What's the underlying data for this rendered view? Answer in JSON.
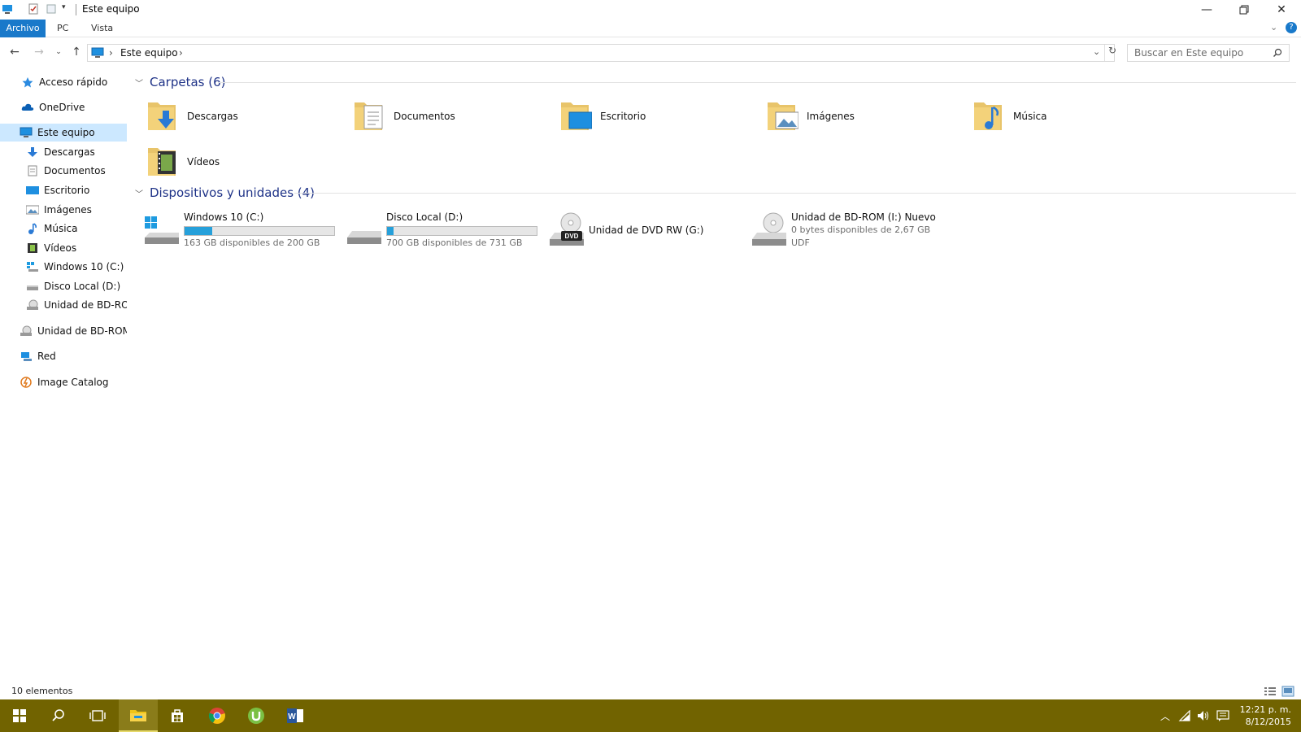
{
  "window": {
    "title": "Este equipo"
  },
  "ribbon": {
    "tabs": [
      "Archivo",
      "PC",
      "Vista"
    ]
  },
  "address": {
    "crumb": "Este equipo",
    "separator": "›"
  },
  "search": {
    "placeholder": "Buscar en Este equipo"
  },
  "sidebar": {
    "items": [
      {
        "label": "Acceso rápido",
        "icon": "star-icon"
      },
      {
        "label": "OneDrive",
        "icon": "cloud-icon"
      },
      {
        "label": "Este equipo",
        "icon": "computer-icon"
      },
      {
        "label": "Descargas",
        "icon": "download-icon"
      },
      {
        "label": "Documentos",
        "icon": "document-icon"
      },
      {
        "label": "Escritorio",
        "icon": "desktop-icon"
      },
      {
        "label": "Imágenes",
        "icon": "image-icon"
      },
      {
        "label": "Música",
        "icon": "music-icon"
      },
      {
        "label": "Vídeos",
        "icon": "video-icon"
      },
      {
        "label": "Windows 10 (C:)",
        "icon": "windows-drive-icon"
      },
      {
        "label": "Disco Local (D:)",
        "icon": "drive-icon"
      },
      {
        "label": "Unidad de BD-ROM",
        "icon": "disc-drive-icon"
      },
      {
        "label": "Unidad de BD-ROM (",
        "icon": "disc-drive-icon"
      },
      {
        "label": "Red",
        "icon": "network-icon"
      },
      {
        "label": "Image Catalog",
        "icon": "catalog-icon"
      }
    ]
  },
  "groups": {
    "folders_title": "Carpetas (6)",
    "devices_title": "Dispositivos y unidades (4)"
  },
  "folders": [
    {
      "name": "Descargas",
      "icon": "download-folder-icon"
    },
    {
      "name": "Documentos",
      "icon": "documents-folder-icon"
    },
    {
      "name": "Escritorio",
      "icon": "desktop-folder-icon"
    },
    {
      "name": "Imágenes",
      "icon": "pictures-folder-icon"
    },
    {
      "name": "Música",
      "icon": "music-folder-icon"
    },
    {
      "name": "Vídeos",
      "icon": "videos-folder-icon"
    }
  ],
  "drives": [
    {
      "name": "Windows 10 (C:)",
      "free": "163 GB disponibles de 200 GB",
      "used_fraction": 0.185,
      "icon": "windows-drive-icon"
    },
    {
      "name": "Disco Local (D:)",
      "free": "700 GB disponibles de 731 GB",
      "used_fraction": 0.042,
      "icon": "drive-icon"
    },
    {
      "name": "Unidad de DVD RW (G:)",
      "icon": "dvd-drive-icon"
    },
    {
      "name": "Unidad de BD-ROM (I:) Nuevo",
      "free": "0 bytes disponibles de 2,67 GB",
      "fs": "UDF",
      "icon": "disc-drive-icon"
    }
  ],
  "status": {
    "count": "10 elementos"
  },
  "taskbar": {
    "time": "12:21 p. m.",
    "date": "8/12/2015",
    "accent": "#716300"
  }
}
